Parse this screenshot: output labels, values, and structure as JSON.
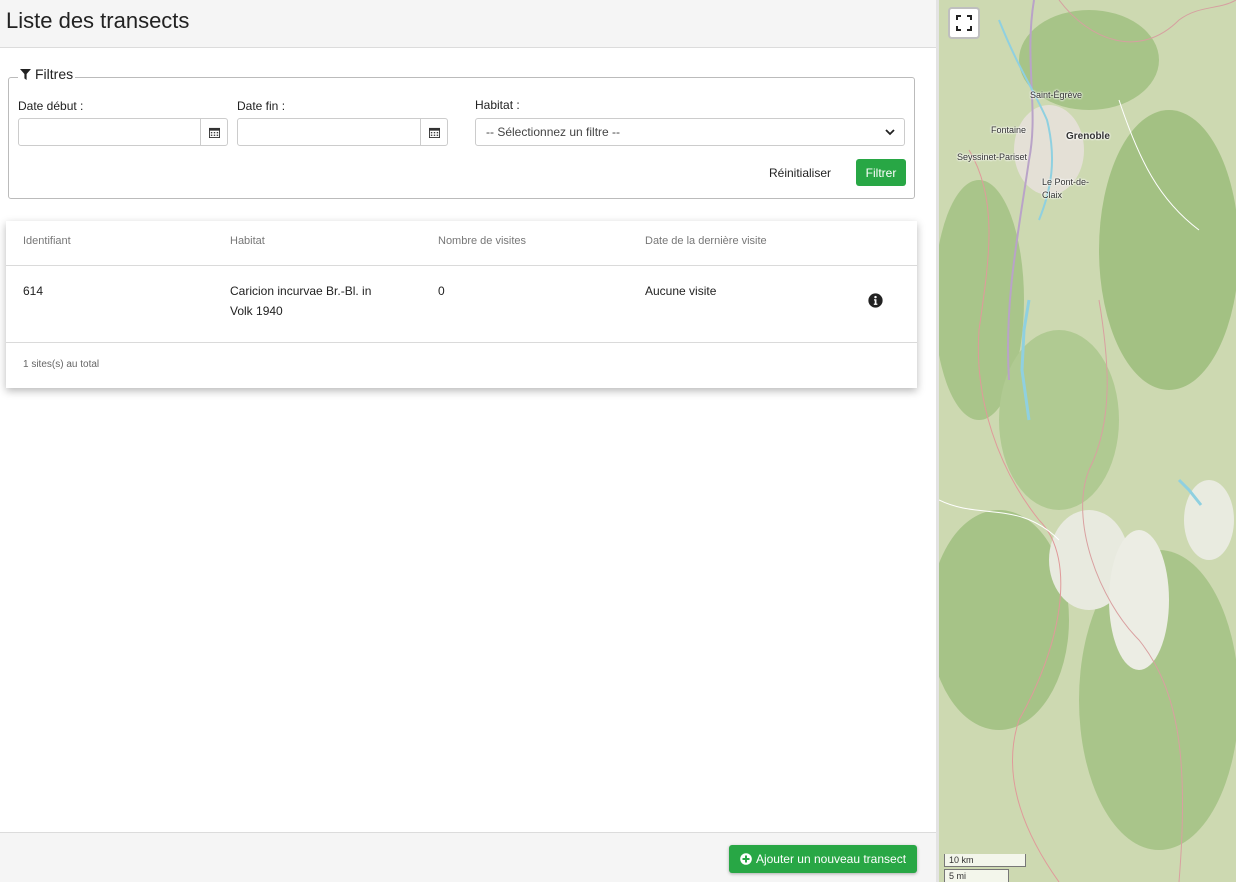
{
  "page": {
    "title": "Liste des transects"
  },
  "filters": {
    "legend": "Filtres",
    "date_debut_label": "Date début :",
    "date_fin_label": "Date fin :",
    "habitat_label": "Habitat :",
    "habitat_placeholder": "-- Sélectionnez un filtre --",
    "reset_label": "Réinitialiser",
    "filter_label": "Filtrer"
  },
  "table": {
    "headers": [
      "Identifiant",
      "Habitat",
      "Nombre de visites",
      "Date de la dernière visite"
    ],
    "rows": [
      {
        "id": "614",
        "habitat": "Caricion incurvae Br.-Bl. in Volk 1940",
        "visites": "0",
        "derniere_visite": "Aucune visite"
      }
    ],
    "total": "1 sites(s) au total"
  },
  "actions": {
    "add_label": "Ajouter un nouveau transect"
  },
  "map": {
    "labels": [
      "Saint-Égrève",
      "Fontaine",
      "Grenoble",
      "Seyssinet-Pariset",
      "Le Pont-de-",
      "Claix"
    ],
    "scale_km": "10 km",
    "scale_mi": "5 mi"
  },
  "colors": {
    "accent_green": "#28a745",
    "map_forest": "#a9c58a",
    "map_water": "#8fd0e0"
  }
}
